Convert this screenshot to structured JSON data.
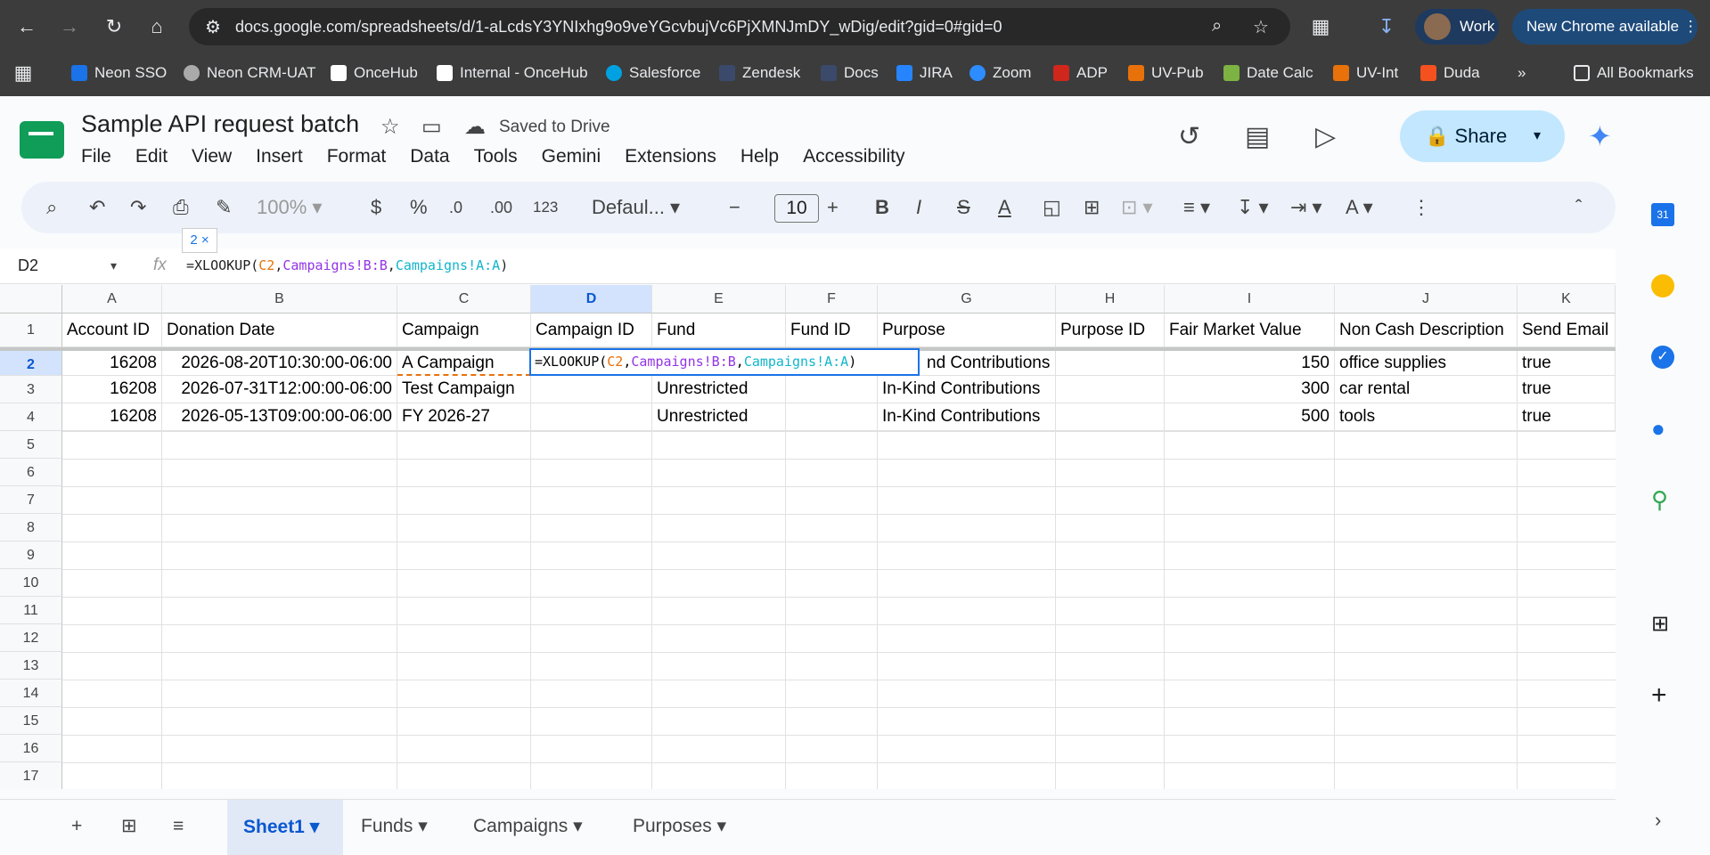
{
  "browser": {
    "url": "docs.google.com/spreadsheets/d/1-aLcdsY3YNIxhg9o9veYGcvbujVc6PjXMNJmDY_wDig/edit?gid=0#gid=0",
    "profile_label": "Work",
    "update_label": "New Chrome available",
    "bookmarks": [
      "Neon SSO",
      "Neon CRM-UAT",
      "OnceHub",
      "Internal - OnceHub",
      "Salesforce",
      "Zendesk",
      "Docs",
      "JIRA",
      "Zoom",
      "ADP",
      "UV-Pub",
      "Date Calc",
      "UV-Int",
      "Duda"
    ],
    "all_bookmarks": "All Bookmarks",
    "more": "»"
  },
  "doc": {
    "title": "Sample API request batch",
    "saved_status": "Saved to Drive",
    "menu": [
      "File",
      "Edit",
      "View",
      "Insert",
      "Format",
      "Data",
      "Tools",
      "Gemini",
      "Extensions",
      "Help",
      "Accessibility"
    ],
    "share_label": "Share"
  },
  "toolbar": {
    "zoom": "100%",
    "currency": "$",
    "percent": "%",
    "dec_decrease": ".0",
    "dec_increase": ".00",
    "number_format": "123",
    "font": "Defaul...",
    "font_size": "10",
    "minus": "−",
    "plus": "+",
    "bold": "B",
    "italic": "I",
    "text_color": "A",
    "tooltip_badge": "2"
  },
  "formula_bar": {
    "cell_ref": "D2",
    "fx": "fx",
    "formula_parts": [
      "=XLOOKUP(",
      "C2",
      ",",
      "Campaigns!B:B",
      ",",
      "Campaigns!A:A",
      ")"
    ]
  },
  "sheet": {
    "columns": [
      "A",
      "B",
      "C",
      "D",
      "E",
      "F",
      "G",
      "H",
      "I",
      "J",
      "K"
    ],
    "headers": [
      "Account ID",
      "Donation Date",
      "Campaign",
      "Campaign ID",
      "Fund",
      "Fund ID",
      "Purpose",
      "Purpose ID",
      "Fair Market Value",
      "Non Cash Description",
      "Send Email"
    ],
    "rows": [
      [
        "16208",
        "2026-08-20T10:30:00-06:00",
        "A Campaign",
        "",
        "",
        "",
        "nd Contributions",
        "",
        "150",
        "office supplies",
        "true"
      ],
      [
        "16208",
        "2026-07-31T12:00:00-06:00",
        "Test Campaign",
        "",
        "Unrestricted",
        "",
        "In-Kind Contributions",
        "",
        "300",
        "car rental",
        "true"
      ],
      [
        "16208",
        "2026-05-13T09:00:00-06:00",
        "FY 2026-27",
        "",
        "Unrestricted",
        "",
        "In-Kind Contributions",
        "",
        "500",
        "tools",
        "true"
      ]
    ],
    "row_numbers": [
      "1",
      "2",
      "3",
      "4",
      "5",
      "6",
      "7",
      "8",
      "9",
      "10",
      "11",
      "12",
      "13",
      "14",
      "15",
      "16",
      "17"
    ]
  },
  "tabs": {
    "sheets": [
      "Sheet1",
      "Funds",
      "Campaigns",
      "Purposes"
    ],
    "active": "Sheet1"
  },
  "colors": {
    "accent": "#1a73e8",
    "c2_ref": "#e8710a",
    "b_ref": "#9334e6",
    "a_ref": "#12b5cb",
    "share_bg": "#c2e7ff"
  }
}
